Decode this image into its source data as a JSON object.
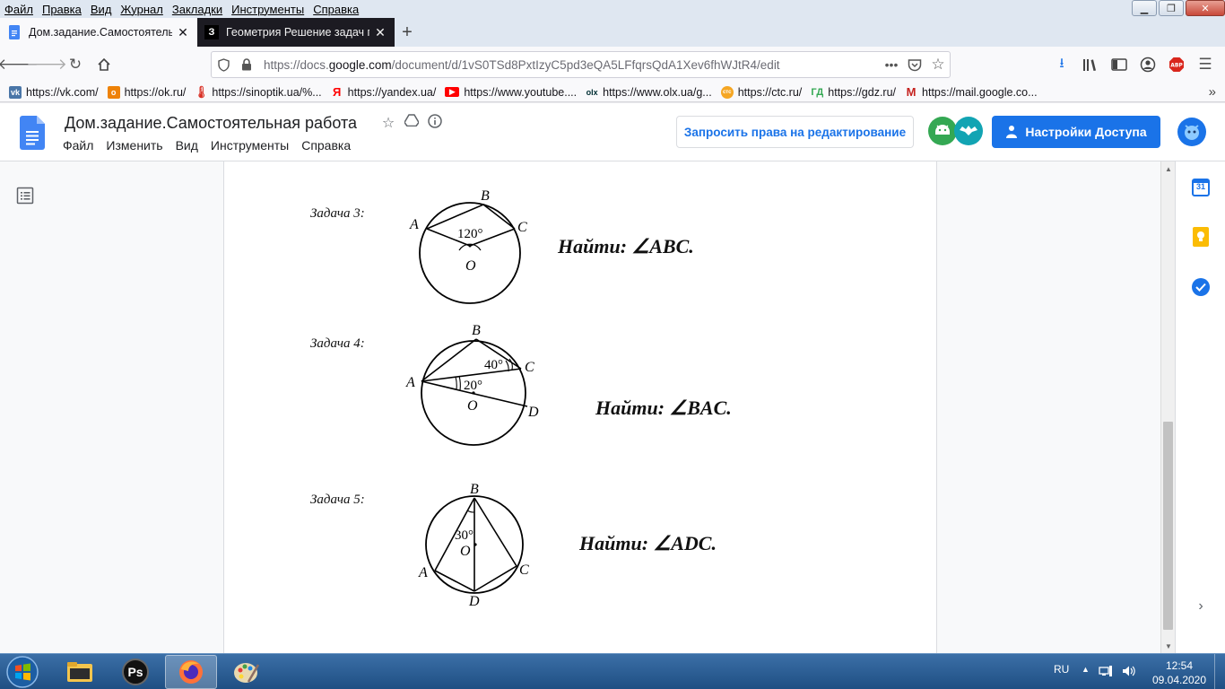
{
  "menubar": {
    "items": [
      "Файл",
      "Правка",
      "Вид",
      "Журнал",
      "Закладки",
      "Инструменты",
      "Справка"
    ]
  },
  "tabs": [
    {
      "title": "Дом.задание.Самостоятельна",
      "active": true
    },
    {
      "title": "Геометрия Решение задач по",
      "active": false
    }
  ],
  "navbar": {
    "url_prefix": "https://docs.",
    "url_host": "google.com",
    "url_path": "/document/d/1vS0TSd8PxtIzyC5pd3eQA5LFfqrsQdA1Xev6fhWJtR4/edit",
    "more_label": "•••"
  },
  "bookmarks": [
    {
      "label": "https://vk.com/",
      "icon": "vk-icon",
      "color": "#4a76a8"
    },
    {
      "label": "https://ok.ru/",
      "icon": "ok-icon",
      "color": "#ee8208"
    },
    {
      "label": "https://sinoptik.ua/%...",
      "icon": "thermometer-icon",
      "color": "#d93025"
    },
    {
      "label": "https://yandex.ua/",
      "icon": "yandex-icon",
      "color": "#ff0000"
    },
    {
      "label": "https://www.youtube....",
      "icon": "youtube-icon",
      "color": "#ff0000"
    },
    {
      "label": "https://www.olx.ua/g...",
      "icon": "olx-icon",
      "color": "#002f34"
    },
    {
      "label": "https://ctc.ru/",
      "icon": "ctc-icon",
      "color": "#f5a623"
    },
    {
      "label": "https://gdz.ru/",
      "icon": "gdz-icon",
      "color": "#34a853"
    },
    {
      "label": "https://mail.google.co...",
      "icon": "gmail-icon",
      "color": "#c5221f"
    }
  ],
  "docs": {
    "title": "Дом.задание.Самостоятельная работа",
    "menu": [
      "Файл",
      "Изменить",
      "Вид",
      "Инструменты",
      "Справка"
    ],
    "request_edit": "Запросить права на редактирование",
    "share": "Настройки Доступа"
  },
  "tasks": [
    {
      "label": "Задача 3:",
      "find": "Найти: ∠ABC.",
      "points": [
        "A",
        "B",
        "C",
        "O"
      ],
      "angles": [
        "120°"
      ]
    },
    {
      "label": "Задача 4:",
      "find": "Найти: ∠BAC.",
      "points": [
        "A",
        "B",
        "C",
        "D",
        "O"
      ],
      "angles": [
        "40°",
        "20°"
      ]
    },
    {
      "label": "Задача 5:",
      "find": "Найти: ∠ADC.",
      "points": [
        "A",
        "B",
        "C",
        "D",
        "O"
      ],
      "angles": [
        "30°"
      ]
    }
  ],
  "sidepanel": {
    "calendar_day": "31"
  },
  "taskbar": {
    "apps": [
      "explorer-icon",
      "photoshop-icon",
      "firefox-icon",
      "paint-icon"
    ],
    "ps_label": "Ps",
    "lang": "RU",
    "time": "12:54",
    "date": "09.04.2020"
  },
  "colors": {
    "accent": "#1a73e8",
    "tab_inactive": "#1c1b22",
    "taskbar": "#2a5a8f"
  }
}
